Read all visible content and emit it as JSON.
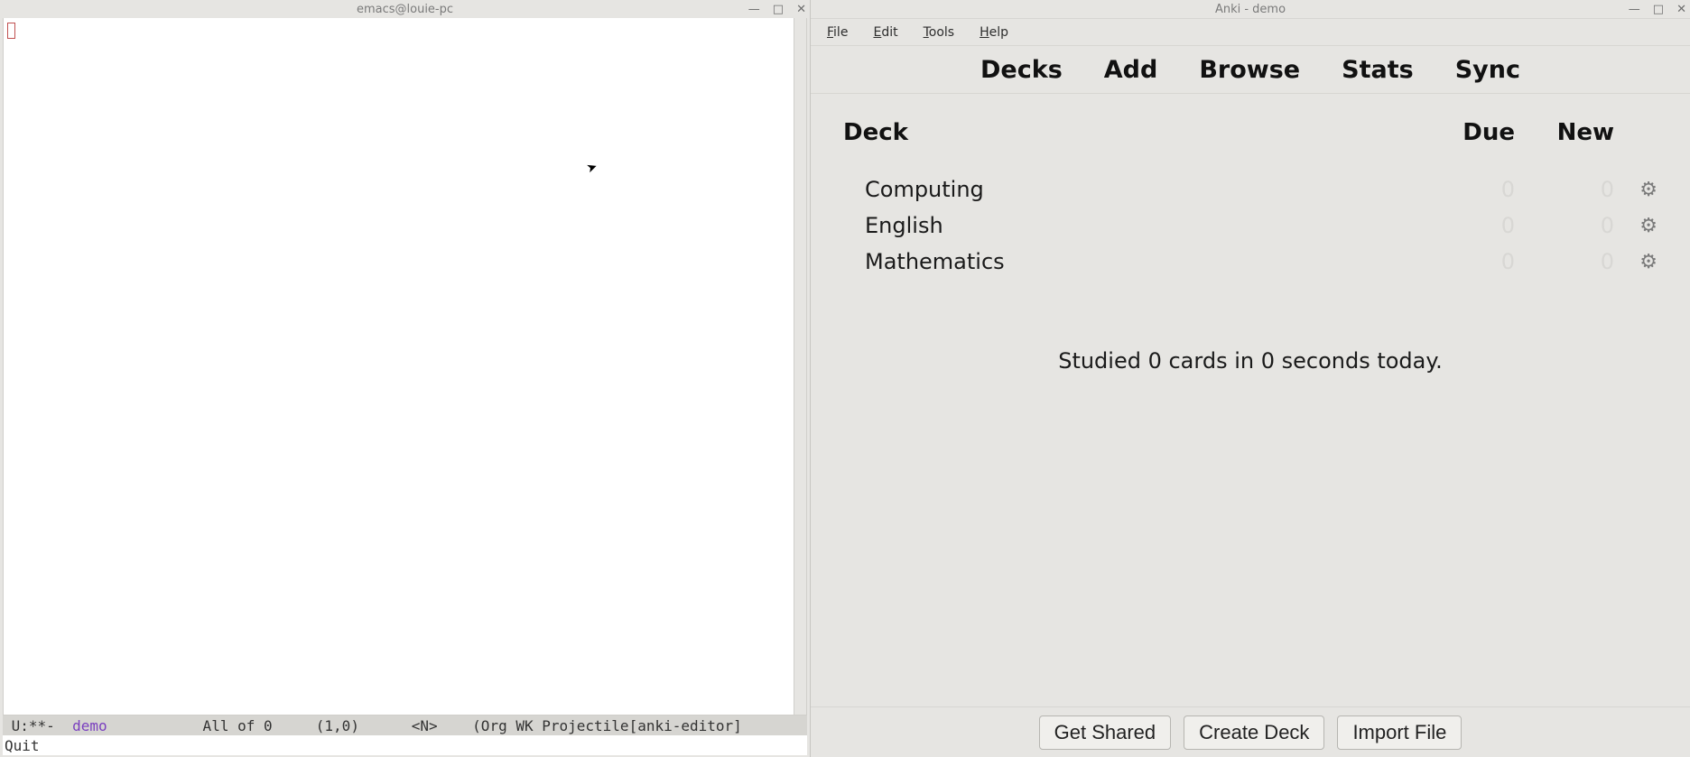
{
  "emacs": {
    "title": "emacs@louie-pc",
    "modeline": {
      "prefix": " U:**-  ",
      "buffer": "demo",
      "rest": "           All of 0     (1,0)      <N>    (Org WK Projectile[anki-editor]"
    },
    "echo": "Quit"
  },
  "anki": {
    "title": "Anki - demo",
    "menu": {
      "file": "File",
      "edit": "Edit",
      "tools": "Tools",
      "help": "Help"
    },
    "toolbar": {
      "decks": "Decks",
      "add": "Add",
      "browse": "Browse",
      "stats": "Stats",
      "sync": "Sync"
    },
    "headers": {
      "deck": "Deck",
      "due": "Due",
      "new": "New"
    },
    "decks": [
      {
        "name": "Computing",
        "due": "0",
        "new": "0"
      },
      {
        "name": "English",
        "due": "0",
        "new": "0"
      },
      {
        "name": "Mathematics",
        "due": "0",
        "new": "0"
      }
    ],
    "summary": "Studied 0 cards in 0 seconds today.",
    "buttons": {
      "shared": "Get Shared",
      "create": "Create Deck",
      "import": "Import File"
    }
  }
}
